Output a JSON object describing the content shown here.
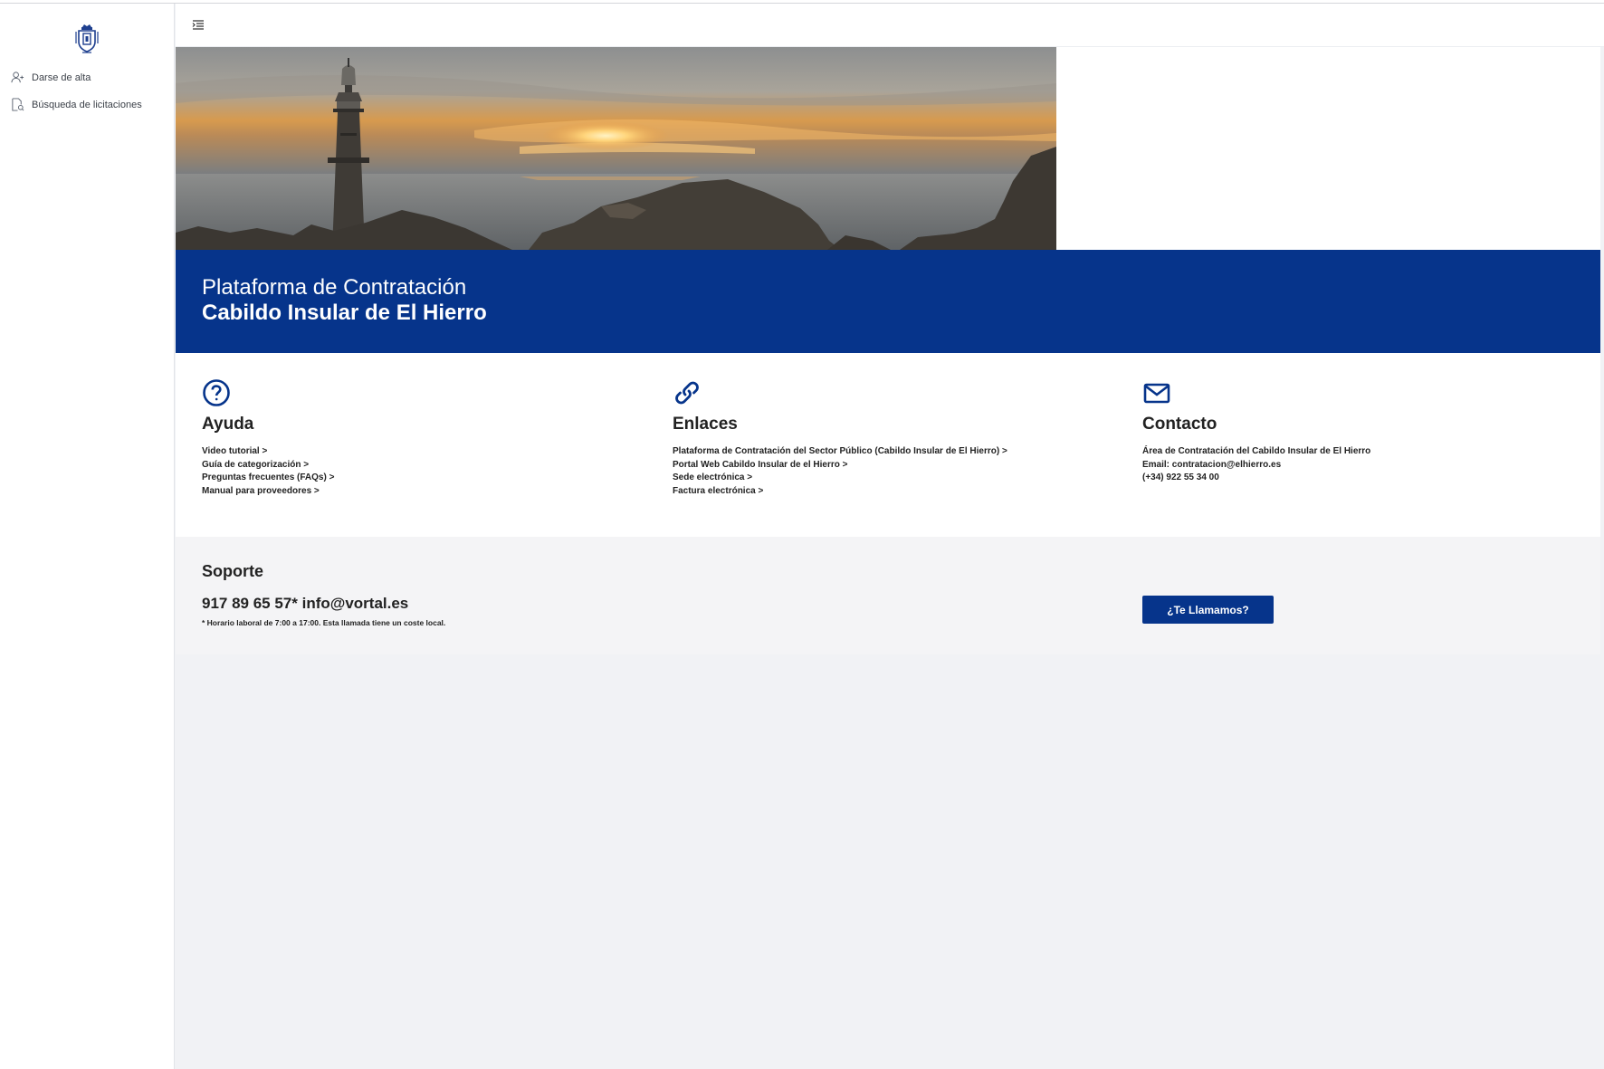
{
  "colors": {
    "primary": "#06348b",
    "support_bg": "#f4f4f6"
  },
  "sidebar": {
    "logo_icon": "coat-of-arms-icon",
    "items": [
      {
        "label": "Darse de alta",
        "icon": "user-plus-icon"
      },
      {
        "label": "Búsqueda de licitaciones",
        "icon": "document-search-icon"
      }
    ]
  },
  "header": {
    "toggle_icon": "menu-indent-icon"
  },
  "banner": {
    "line1": "Plataforma de Contratación",
    "line2": "Cabildo Insular de El Hierro"
  },
  "ayuda": {
    "title": "Ayuda",
    "icon": "question-circle-icon",
    "links": [
      "Video tutorial >",
      "Guía de categorización >",
      "Preguntas frecuentes (FAQs) >",
      "Manual para proveedores >"
    ]
  },
  "enlaces": {
    "title": "Enlaces",
    "icon": "link-icon",
    "links": [
      "Plataforma de Contratación del Sector Público (Cabildo Insular de El Hierro) >",
      "Portal Web Cabildo Insular de el Hierro >",
      "Sede electrónica >",
      "Factura electrónica >"
    ]
  },
  "contacto": {
    "title": "Contacto",
    "icon": "envelope-icon",
    "lines": [
      "Área de Contratación del Cabildo Insular de El Hierro",
      "Email: contratacion@elhierro.es",
      "(+34) 922 55 34 00"
    ]
  },
  "soporte": {
    "title": "Soporte",
    "phone": "917 89 65 57* info@vortal.es",
    "note": "* Horario laboral de 7:00 a 17:00. Esta llamada tiene un coste local.",
    "button": "¿Te Llamamos?"
  }
}
